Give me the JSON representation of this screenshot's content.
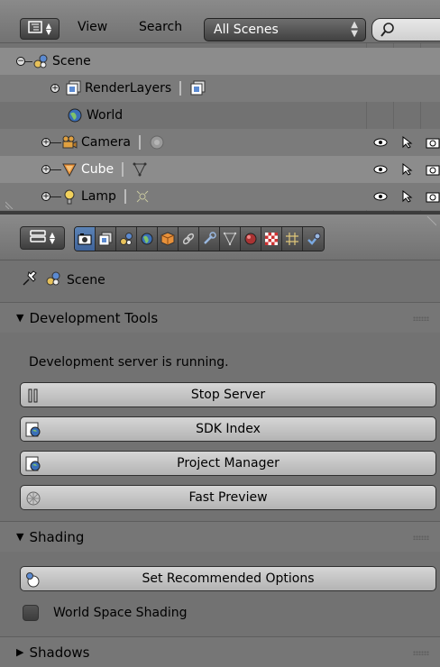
{
  "outliner": {
    "menus": [
      "View",
      "Search"
    ],
    "display_mode": "All Scenes",
    "search_placeholder": "",
    "rows": [
      {
        "label": "Scene",
        "icon": "scene-icon",
        "selected": true
      },
      {
        "label": "RenderLayers",
        "icon": "render-layers-icon"
      },
      {
        "label": "World",
        "icon": "world-icon"
      },
      {
        "label": "Camera",
        "icon": "camera-icon"
      },
      {
        "label": "Cube",
        "icon": "cube-icon"
      },
      {
        "label": "Lamp",
        "icon": "lamp-icon"
      }
    ]
  },
  "properties": {
    "context_tabs": [
      "render-icon",
      "render-layers-icon",
      "scene-icon",
      "world-icon",
      "object-icon",
      "constraints-icon",
      "modifiers-icon",
      "mesh-data-icon",
      "material-icon",
      "texture-icon",
      "particles-icon",
      "physics-icon"
    ],
    "active_tab": "render-icon",
    "context_path": "Scene",
    "panels": {
      "dev_tools": {
        "title": "Development Tools",
        "status": "Development server is running.",
        "buttons": [
          "Stop Server",
          "SDK Index",
          "Project Manager",
          "Fast Preview"
        ]
      },
      "shading": {
        "title": "Shading",
        "button": "Set Recommended Options",
        "checkbox_label": "World Space Shading",
        "checkbox_checked": false
      },
      "shadows": {
        "title": "Shadows"
      }
    }
  },
  "colors": {
    "active_tab": "#5277ad",
    "selected_row": "#8c8c8c",
    "background": "#727272"
  }
}
